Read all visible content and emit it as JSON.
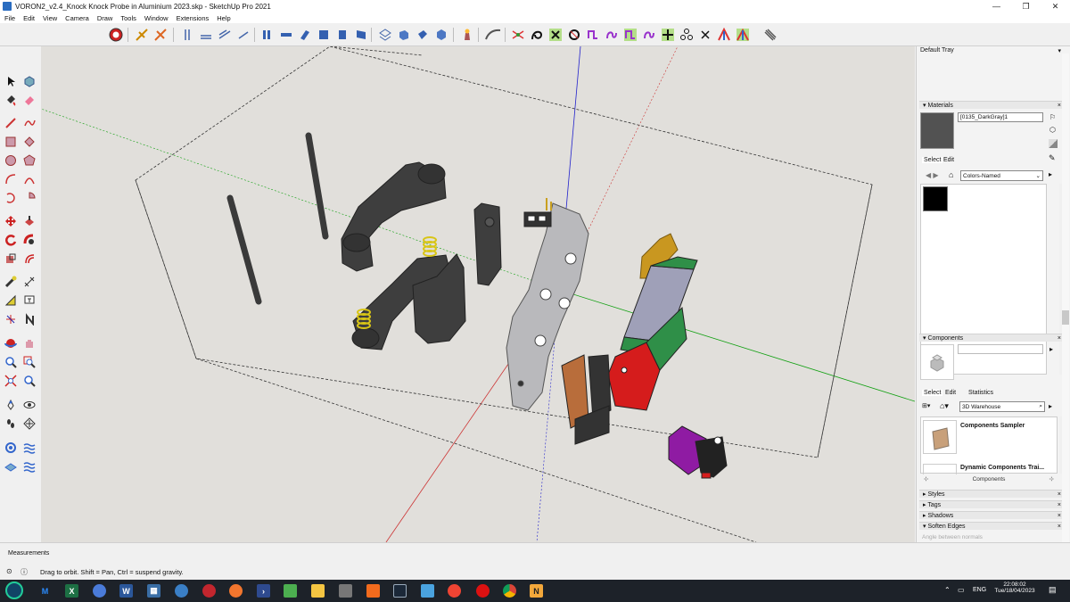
{
  "window": {
    "title": "VORON2_v2.4_Knock Knock Probe in Aluminium 2023.skp - SketchUp Pro 2021",
    "minimize": "—",
    "maximize": "❐",
    "close": "✕"
  },
  "menu": {
    "items": [
      "File",
      "Edit",
      "View",
      "Camera",
      "Draw",
      "Tools",
      "Window",
      "Extensions",
      "Help"
    ]
  },
  "toolbar": {
    "icons": [
      "model-info-icon",
      "xray-icon",
      "section-icon",
      "axes-icon",
      "guides-icon",
      "iso-view-icon",
      "top-view-icon",
      "front-view-icon",
      "right-view-icon",
      "back-view-icon",
      "left-view-icon",
      "bottom-view-icon",
      "wireframe-icon",
      "hidden-line-icon",
      "shaded-icon",
      "textured-icon",
      "monochrome-icon",
      "extension-warehouse-icon",
      "dynamic-components-icon",
      "curve-tool-icon",
      "bezier-icon",
      "fredo-curvizard-icon",
      "fredo-join-icon",
      "fredo-split-icon",
      "fredo-edit-icon",
      "fredo-scale-icon",
      "fredo-rotate-icon",
      "fredo-move-icon",
      "fredo-tools-icon",
      "fredo-vertex-icon",
      "fredo-cross-icon",
      "fredo-shape-icon",
      "fredo-grid-icon",
      "fredo-config-icon"
    ]
  },
  "left_toolbar": {
    "tools": [
      "select-icon",
      "component-icon",
      "paint-bucket-icon",
      "eraser-icon",
      "line-icon",
      "freehand-icon",
      "rectangle-icon",
      "rotated-rectangle-icon",
      "circle-icon",
      "polygon-icon",
      "arc-icon",
      "pie-icon",
      "three-point-arc-icon",
      "two-point-arc-icon",
      "move-icon",
      "push-pull-icon",
      "rotate-icon",
      "follow-me-icon",
      "scale-icon",
      "offset-icon",
      "tape-measure-icon",
      "dimension-icon",
      "protractor-icon",
      "text-icon",
      "axes-tool-icon",
      "3d-text-icon",
      "orbit-icon",
      "pan-icon",
      "zoom-icon",
      "zoom-window-icon",
      "zoom-extents-icon",
      "previous-view-icon",
      "position-camera-icon",
      "look-around-icon",
      "walk-icon",
      "section-plane-icon",
      "sandbox-icon",
      "sandbox-drape-icon",
      "sandbox-stamp-icon",
      "sandbox-smoove-icon"
    ]
  },
  "tray": {
    "title": "Default Tray",
    "pin": "📌",
    "materials": {
      "header": "Materials",
      "material_name": "[0135_DarkGray]1",
      "current_color": "#525252",
      "tabs": [
        "Select",
        "Edit"
      ],
      "library": "Colors-Named",
      "swatch_color": "#000000"
    },
    "components": {
      "header": "Components",
      "tabs": [
        "Select",
        "Edit",
        "Statistics"
      ],
      "search_placeholder": "3D Warehouse",
      "items": [
        {
          "name": "Components Sampler"
        },
        {
          "name": "Dynamic Components Trai..."
        }
      ],
      "footer": "Components"
    },
    "collapsed_sections": [
      "Styles",
      "Tags",
      "Shadows"
    ],
    "soften_edges": {
      "header": "Soften Edges",
      "label": "Angle between normals"
    }
  },
  "statusbar": {
    "measurements_label": "Measurements",
    "hint": "Drag to orbit. Shift = Pan, Ctrl = suspend gravity."
  },
  "taskbar": {
    "time": "22:08:02",
    "date": "Tue/18/04/2023",
    "language": "ENG",
    "apps": [
      "start-icon",
      "mail-icon",
      "excel-icon",
      "chrome-canary-icon",
      "word-icon",
      "calculator-icon",
      "sketchup-icon",
      "vivaldi-icon",
      "firefox-icon",
      "powershell-icon",
      "notepad-icon",
      "file-explorer-icon",
      "inkscape-icon",
      "orange-app-icon",
      "steam-icon",
      "cura-icon",
      "snip-icon",
      "opera-icon",
      "chrome-icon",
      "notepad-plus-icon"
    ]
  },
  "colors": {
    "viewport_bg": "#e1dfdb",
    "part_dark": "#3e3e3e",
    "part_light": "#b9b9bc",
    "spring": "#f1e21e",
    "red_block": "#d51c1c",
    "green_rail": "#2f8f48",
    "purple_block": "#8f1ba3",
    "brown_clip": "#b86d3b",
    "yellow_part": "#c99720",
    "axis_blue": "#2222cc",
    "axis_green": "#12a012",
    "axis_red": "#cc3333"
  }
}
